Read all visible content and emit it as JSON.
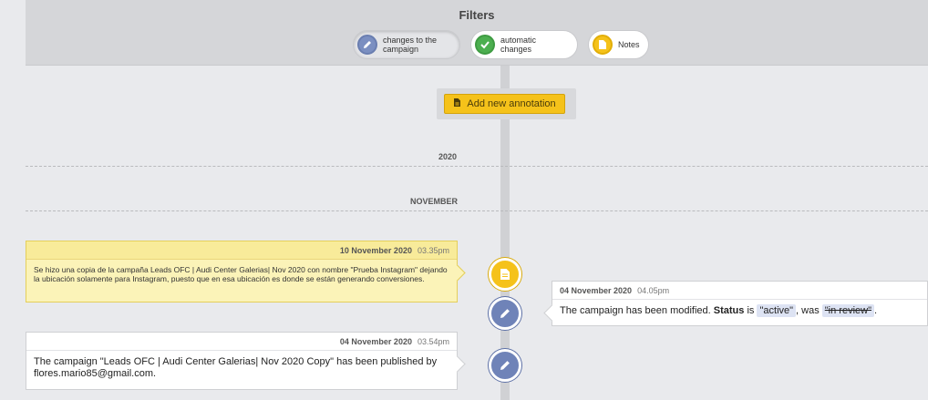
{
  "filters": {
    "title": "Filters",
    "items": [
      {
        "label_line1": "changes to the",
        "label_line2": "campaign",
        "icon": "pencil-icon",
        "active": true
      },
      {
        "label": "automatic changes",
        "icon": "check-icon",
        "active": false
      },
      {
        "label": "Notes",
        "icon": "document-icon",
        "active": false
      }
    ]
  },
  "add_annotation": {
    "label": "Add new annotation"
  },
  "separators": {
    "year": "2020",
    "month": "NOVEMBER"
  },
  "events": [
    {
      "type": "note",
      "date": "10 November 2020",
      "time": "03.35pm",
      "text": "Se hizo una copia de la campaña Leads OFC | Audi Center Galerias| Nov 2020 con nombre \"Prueba Instagram\" dejando la ubicación solamente para Instagram, puesto que en esa ubicación es donde se están generando conversiones."
    },
    {
      "type": "change",
      "date": "04 November 2020",
      "time": "04.05pm",
      "text_prefix": "The campaign has been modified.",
      "field": "Status",
      "is_word": "is",
      "new_value": "\"active\"",
      "was_word": ", was",
      "old_value": "\"in review\"",
      "suffix": "."
    },
    {
      "type": "change",
      "date": "04 November 2020",
      "time": "03.54pm",
      "text": "The campaign \"Leads OFC | Audi Center Galerias| Nov 2020 Copy\" has been published by flores.mario85@gmail.com."
    }
  ]
}
